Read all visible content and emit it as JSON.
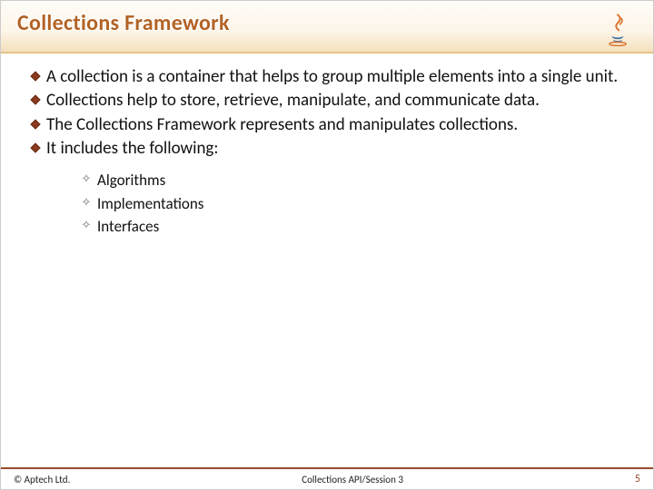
{
  "title": "Collections Framework",
  "bullets": [
    "A collection is a container that helps to group multiple elements into a single unit.",
    "Collections help to store, retrieve, manipulate, and communicate data.",
    "The Collections Framework represents and manipulates collections.",
    "It includes the following:"
  ],
  "sub_bullets": [
    "Algorithms",
    "Implementations",
    "Interfaces"
  ],
  "footer": {
    "copyright": "© Aptech Ltd.",
    "session": "Collections API/Session 3",
    "page": "5"
  }
}
